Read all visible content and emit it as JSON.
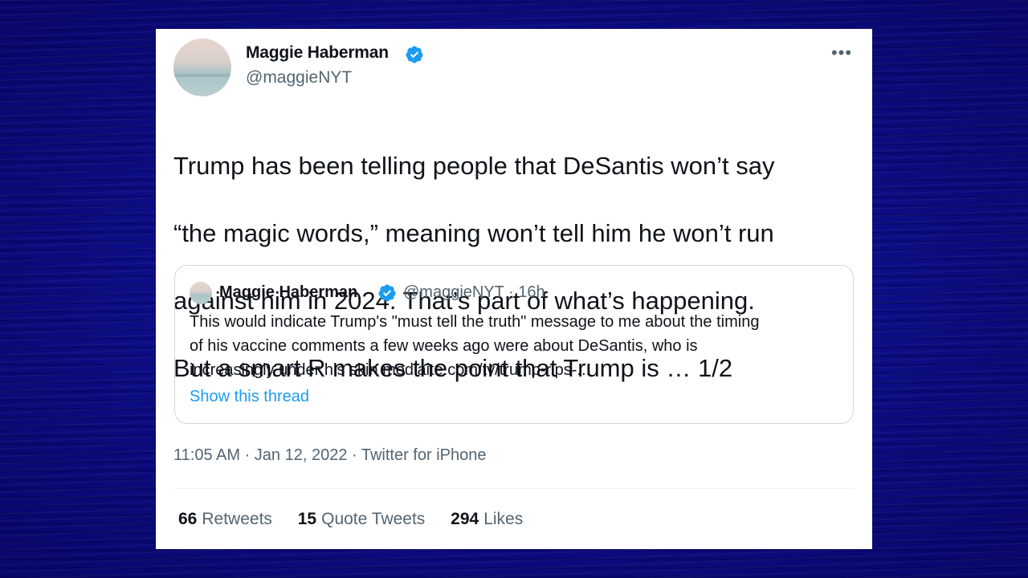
{
  "tweet": {
    "author_name": "Maggie Haberman",
    "handle": "@maggieNYT",
    "more_icon": "•••",
    "text_lines": [
      "Trump has been telling people that DeSantis won’t say",
      "“the magic words,” meaning won’t tell him he won’t run",
      "against him in 2024. That’s part of what’s happening.",
      "But a smart R makes the point that Trump is … 1/2"
    ],
    "meta": "11:05 AM · Jan 12, 2022 · Twitter for iPhone",
    "stats": {
      "retweets_count": "66",
      "retweets_label": "Retweets",
      "quotes_count": "15",
      "quotes_label": "Quote Tweets",
      "likes_count": "294",
      "likes_label": "Likes"
    }
  },
  "quoted_tweet": {
    "author_name": "Maggie Haberman",
    "handle_time": "@maggieNYT · 16h",
    "text_lines": [
      "This would indicate Trump's \"must tell the truth\" message to me about the timing",
      "of his vaccine comments a few weeks ago were about DeSantis, who is",
      "increasingly under his skin mediaite.com/tv/trump-rips-..."
    ],
    "show_thread": "Show this thread"
  },
  "colors": {
    "background": "#0d0d8a",
    "verified": "#1d9bf0",
    "link": "#1d9bf0",
    "secondary_text": "#536471"
  },
  "icons": [
    "verified-badge-icon",
    "more-options-icon",
    "avatar"
  ]
}
